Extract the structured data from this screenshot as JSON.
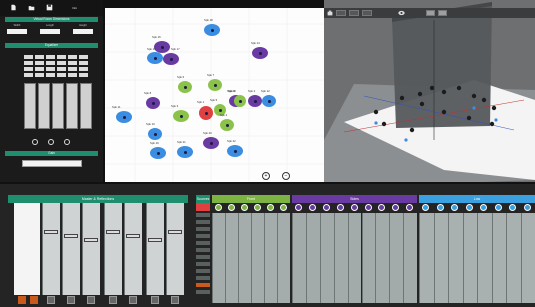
{
  "toolbar": {
    "icons": [
      "new-file-icon",
      "open-folder-icon",
      "save-icon"
    ],
    "info_label": "Info"
  },
  "room": {
    "header": "Virtual Room Dimensions",
    "fields": [
      {
        "label": "Width",
        "value": ""
      },
      {
        "label": "Length",
        "value": ""
      },
      {
        "label": "Height",
        "value": ""
      }
    ]
  },
  "eq": {
    "header": "Equalizer"
  },
  "gain": {
    "header": "Gain",
    "value": ""
  },
  "speakers": [
    {
      "label": "Spk 16",
      "color": "#6a3aa3"
    },
    {
      "label": "Spk 18",
      "color": "#3a8de0"
    },
    {
      "label": "Spk 15",
      "color": "#3a8de0"
    },
    {
      "label": "Spk 17",
      "color": "#6a3aa3"
    },
    {
      "label": "Spk 14",
      "color": "#6a3aa3"
    },
    {
      "label": "Spk 8",
      "color": "#6a3aa3"
    },
    {
      "label": "Spk 6",
      "color": "#8bc34a"
    },
    {
      "label": "Spk 7",
      "color": "#8bc34a"
    },
    {
      "label": "Spk 13",
      "color": "#6a3aa3"
    },
    {
      "label": "Spk 12",
      "color": "#3a8de0"
    },
    {
      "label": "Spk 11",
      "color": "#3a8de0"
    },
    {
      "label": "Spk 9",
      "color": "#8bc34a"
    },
    {
      "label": "Spk 5",
      "color": "#8bc34a"
    },
    {
      "label": "Spk 4",
      "color": "#6a3aa3"
    },
    {
      "label": "Spk 1",
      "color": "#e04040"
    },
    {
      "label": "Spk 2",
      "color": "#8bc34a"
    },
    {
      "label": "Spk 10",
      "color": "#3a8de0"
    },
    {
      "label": "Spk 3",
      "color": "#8bc34a"
    },
    {
      "label": "Spk 19",
      "color": "#3a8de0"
    },
    {
      "label": "Spk 20",
      "color": "#6a3aa3"
    },
    {
      "label": "Spk 21",
      "color": "#3a8de0"
    },
    {
      "label": "Spk 22",
      "color": "#3a8de0"
    }
  ],
  "view3d": {
    "buttons": [
      "",
      "",
      "",
      "",
      ""
    ]
  },
  "mixer": {
    "master_header": "Master & Reflections",
    "sections": [
      {
        "name": "Sources",
        "color": "#1e8e6e"
      },
      {
        "name": "Front",
        "color": "#7cb342"
      },
      {
        "name": "Sides",
        "color": "#6a3aa3"
      },
      {
        "name": "Low",
        "color": "#3aa0e0"
      }
    ]
  },
  "colors": {
    "accent": "#1e8e6e",
    "front": "#8bc34a",
    "sides": "#6a3aa3",
    "low": "#3a8de0",
    "alert": "#e04040"
  }
}
